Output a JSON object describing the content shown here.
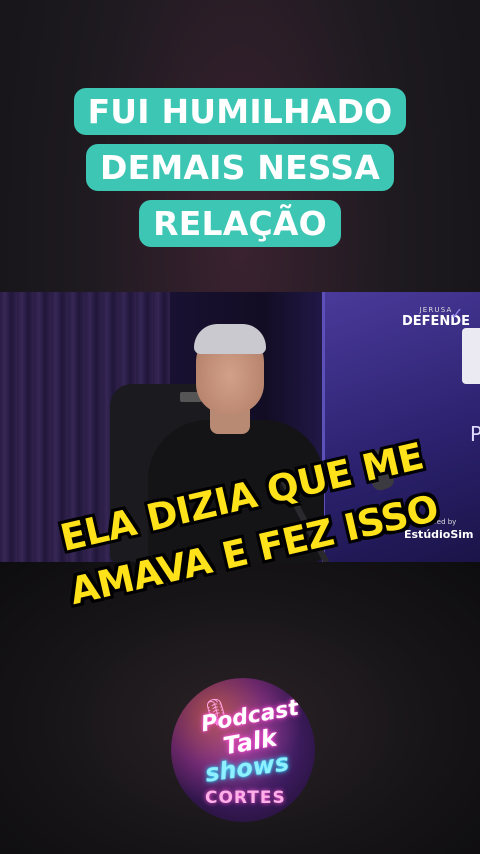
{
  "headline": {
    "lines": [
      "FUI HUMILHADO",
      "DEMAIS NESSA",
      "RELAÇÃO"
    ]
  },
  "video": {
    "brand_small": "JERUSA",
    "brand_big": "DEFENDE",
    "screen_letter": "P",
    "powered_text": "wered by",
    "studio_name": "EstúdioSim"
  },
  "caption": {
    "lines": [
      "ELA DIZIA QUE ME",
      "AMAVA E FEZ ISSO"
    ]
  },
  "logo": {
    "podcast": "Podcast",
    "talk": "Talk",
    "shows": "shows",
    "cortes": "CORTES"
  },
  "colors": {
    "headline_bg": "#3ec6b5",
    "caption_text": "#ffe21a",
    "background": "#1e1a20"
  }
}
